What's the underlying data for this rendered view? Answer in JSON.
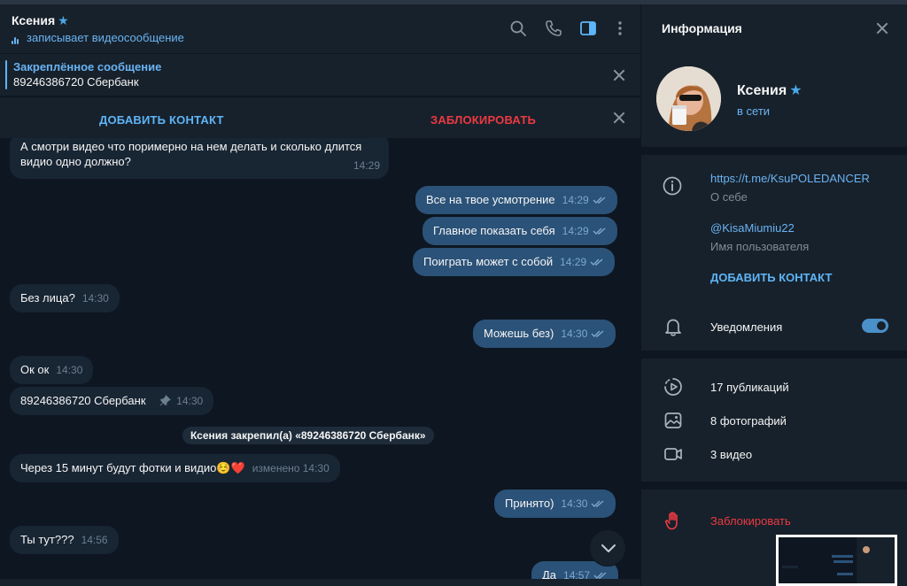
{
  "chat": {
    "name": "Ксения",
    "status": "записывает видеосообщение",
    "pinned": {
      "title": "Закреплённое сообщение",
      "text": "89246386720 Сбербанк"
    },
    "actions": {
      "add_contact": "ДОБАВИТЬ КОНТАКТ",
      "block": "ЗАБЛОКИРОВАТЬ"
    },
    "messages": [
      {
        "dir": "in",
        "line1": "А смотри видео что поримерно на нем делать и сколько длится",
        "line2": "видио одно должно?",
        "time": "14:29"
      },
      {
        "dir": "out",
        "text": "Все на твое усмотрение",
        "time": "14:29"
      },
      {
        "dir": "out",
        "text": "Главное показать себя",
        "time": "14:29"
      },
      {
        "dir": "out",
        "text": "Поиграть может с собой",
        "time": "14:29"
      },
      {
        "dir": "in",
        "text": "Без лица?",
        "time": "14:30"
      },
      {
        "dir": "out",
        "text": "Можешь без)",
        "time": "14:30"
      },
      {
        "dir": "in",
        "text": "Ок ок",
        "time": "14:30"
      },
      {
        "dir": "in",
        "text": "89246386720 Сбербанк",
        "time": "14:30"
      },
      {
        "dir": "service",
        "text": "Ксения закрепил(а) «89246386720 Сбербанк»"
      },
      {
        "dir": "in",
        "text": "Через 15 минут будут фотки и видио☺️❤️",
        "time": "изменено 14:30"
      },
      {
        "dir": "out",
        "text": "Принято)",
        "time": "14:30"
      },
      {
        "dir": "in",
        "text": "Ты тут???",
        "time": "14:56"
      },
      {
        "dir": "out",
        "text": "Да",
        "time": "14:57"
      }
    ]
  },
  "info": {
    "title": "Информация",
    "name": "Ксения",
    "status": "в сети",
    "link": "https://t.me/KsuPOLEDANCER",
    "link_sub": "О себе",
    "username": "@KisaMiumiu22",
    "username_sub": "Имя пользователя",
    "add_contact": "ДОБАВИТЬ КОНТАКТ",
    "notifications": "Уведомления",
    "notifications_on": true,
    "publications": "17 публикаций",
    "photos": "8 фотографий",
    "videos": "3 видео",
    "block": "Заблокировать"
  },
  "colors": {
    "accent": "#6ab3f3",
    "danger": "#ec3942",
    "incoming_bubble": "#182533",
    "outgoing_bubble": "#2b5278"
  }
}
